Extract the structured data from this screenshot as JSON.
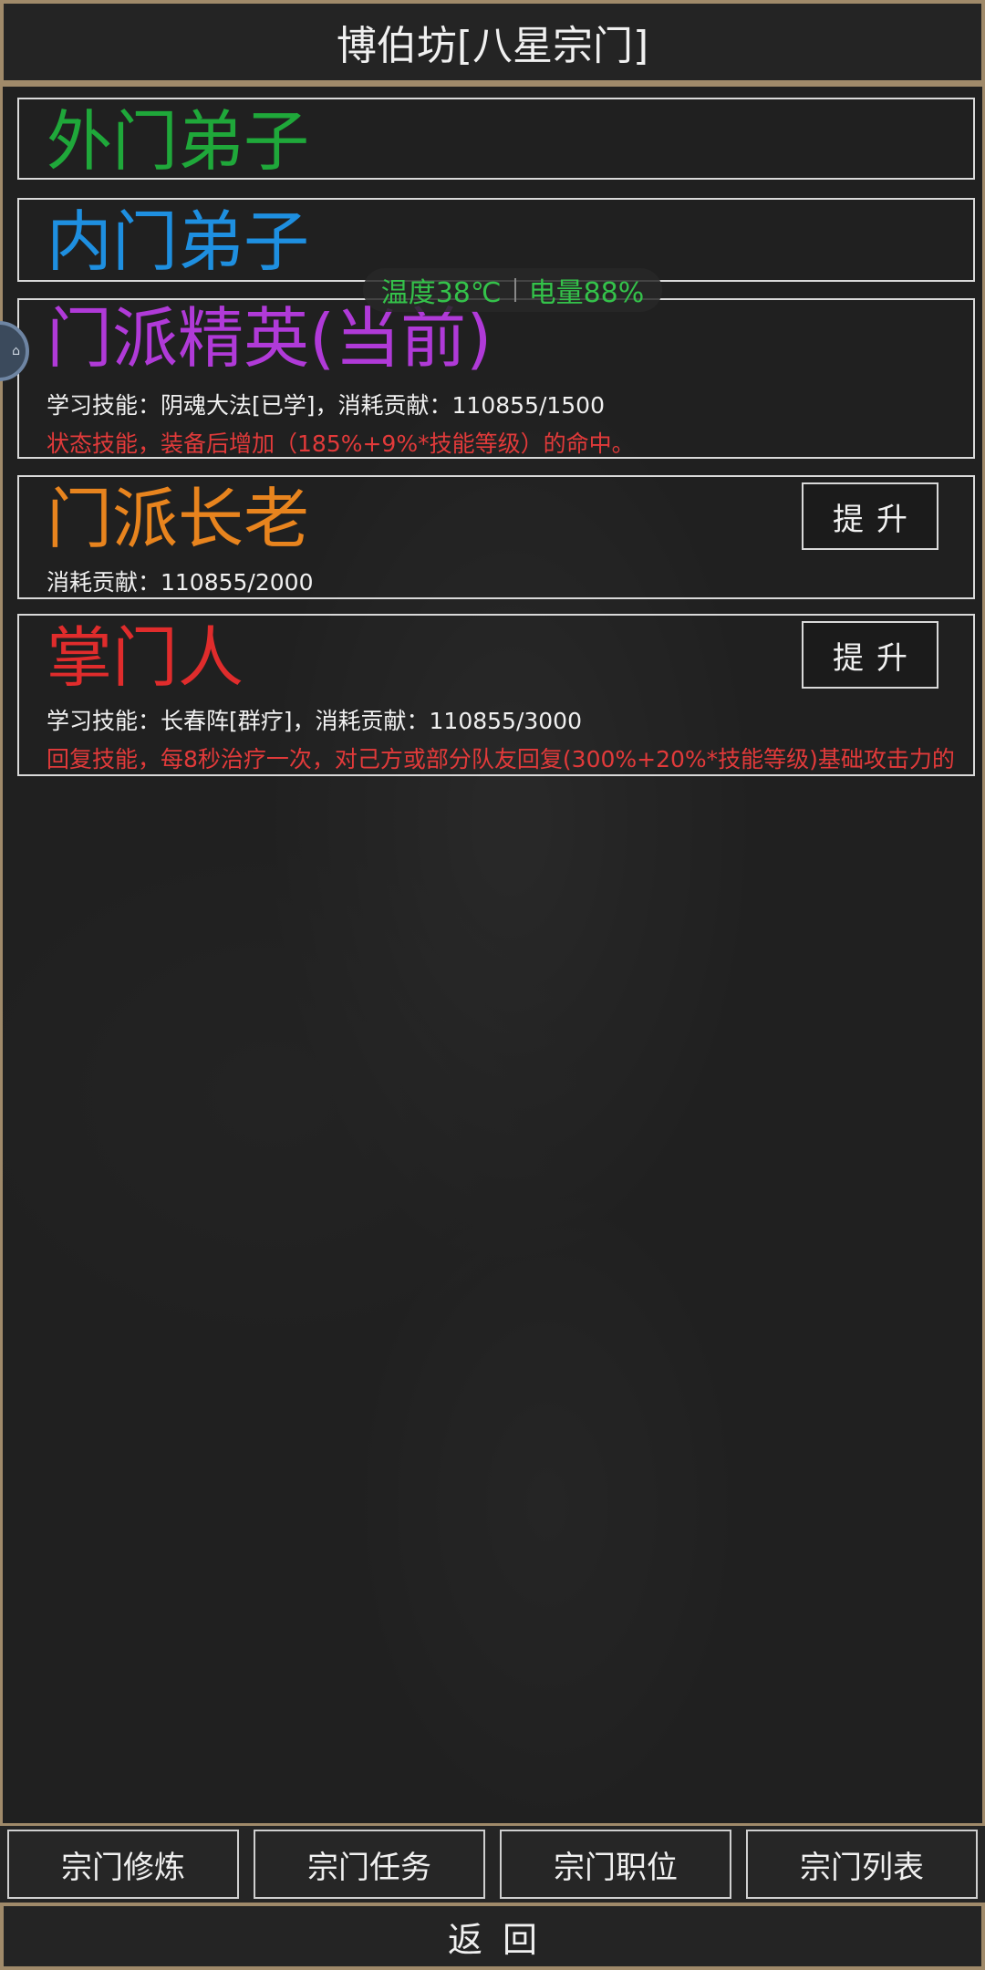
{
  "header": {
    "title": "博伯坊[八星宗门]"
  },
  "status_overlay": {
    "temperature": "温度38℃",
    "battery": "电量88%"
  },
  "ranks": [
    {
      "name": "外门弟子",
      "color": "#1fa83a"
    },
    {
      "name": "内门弟子",
      "color": "#1e8fe0"
    },
    {
      "name": "门派精英(当前)",
      "color": "#b03ad8",
      "line1": "学习技能：阴魂大法[已学]，消耗贡献：110855/1500",
      "line2": "状态技能，装备后增加（185%+9%*技能等级）的命中。"
    },
    {
      "name": "门派长老",
      "color": "#e8841e",
      "line1": "消耗贡献：110855/2000",
      "button": "提升"
    },
    {
      "name": "掌门人",
      "color": "#e02c2c",
      "line1": "学习技能：长春阵[群疗]，消耗贡献：110855/3000",
      "line2": "回复技能，每8秒治疗一次，对己方或部分队友回复(300%+20%*技能等级)基础攻击力的",
      "button": "提升"
    }
  ],
  "tabs": [
    "宗门修炼",
    "宗门任务",
    "宗门职位",
    "宗门列表"
  ],
  "footer": {
    "back_label": "返回"
  },
  "colors": {
    "frame": "#a08a6a",
    "status_green": "#34c24a",
    "desc_red": "#e23a3a"
  }
}
